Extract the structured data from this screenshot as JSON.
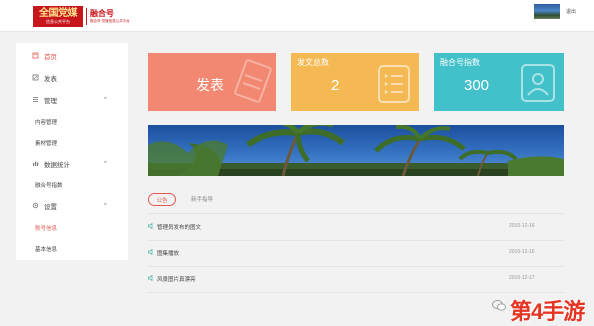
{
  "header": {
    "logo": {
      "main": "全国党媒",
      "sub": "信息公共平台",
      "right_title": "融合号",
      "right_sub": "融合号·党媒信息公共平台"
    },
    "username": "退出"
  },
  "sidebar": {
    "items": [
      {
        "label": "首页",
        "icon": "home-icon",
        "active": true
      },
      {
        "label": "发表",
        "icon": "edit-icon"
      },
      {
        "label": "管理",
        "icon": "list-icon",
        "chevron": "^"
      },
      {
        "label": "内容管理"
      },
      {
        "label": "素材管理"
      },
      {
        "label": "数据统计",
        "icon": "chart-icon",
        "chevron": "^"
      },
      {
        "label": "融合号指数"
      },
      {
        "label": "设置",
        "icon": "gear-icon",
        "chevron": "^"
      },
      {
        "label": "账号信息",
        "active": true
      },
      {
        "label": "基本信息"
      }
    ]
  },
  "cards": {
    "publish": {
      "label": "发表",
      "color": "#f28872"
    },
    "posts": {
      "label": "发文总数",
      "value": "2",
      "color": "#f5b954"
    },
    "index": {
      "label": "融合号指数",
      "value": "300",
      "color": "#43c1cb"
    }
  },
  "tabs": {
    "notice": "公告",
    "guide": "新手指导"
  },
  "notices": [
    {
      "title": "管理员发布的图文",
      "date": "2016-12-16"
    },
    {
      "title": "图集播放",
      "date": "2016-12-16"
    },
    {
      "title": "风景图片真漂亮",
      "date": "2016-12-17"
    }
  ],
  "watermark": {
    "text": "第4手游"
  },
  "colors": {
    "accent": "#e05a4f",
    "brand_red": "#c8161d",
    "teal": "#43c1cb",
    "orange": "#f5b954",
    "salmon": "#f28872"
  }
}
